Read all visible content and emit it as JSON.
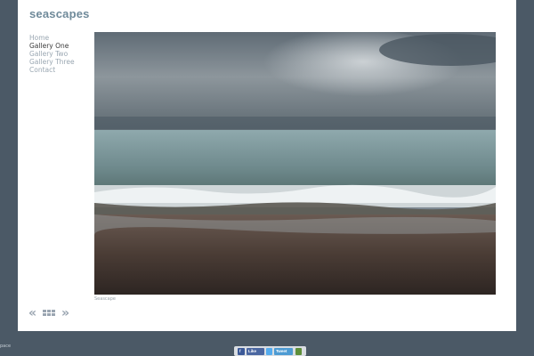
{
  "site": {
    "title": "seascapes"
  },
  "nav": {
    "items": [
      {
        "label": "Home",
        "active": false
      },
      {
        "label": "Gallery One",
        "active": true
      },
      {
        "label": "Gallery Two",
        "active": false
      },
      {
        "label": "Gallery Three",
        "active": false
      },
      {
        "label": "Contact",
        "active": false
      }
    ]
  },
  "photo": {
    "caption": "Seascape",
    "alt_subject": "seascape-photo"
  },
  "controls": {
    "prev_icon": "double-chevron-left-icon",
    "grid_icon": "grid-icon",
    "next_icon": "double-chevron-right-icon",
    "prev_symbol": "«",
    "next_symbol": "»"
  },
  "footer": {
    "left_text": "pace"
  },
  "share": {
    "facebook_icon": "f",
    "like_label": "Like",
    "tweet_label": "Tweet"
  },
  "colors": {
    "background": "#4b5966",
    "title": "#6f8a9a",
    "nav_active": "#3b3b3b",
    "nav_inactive": "#9aa7b2"
  }
}
